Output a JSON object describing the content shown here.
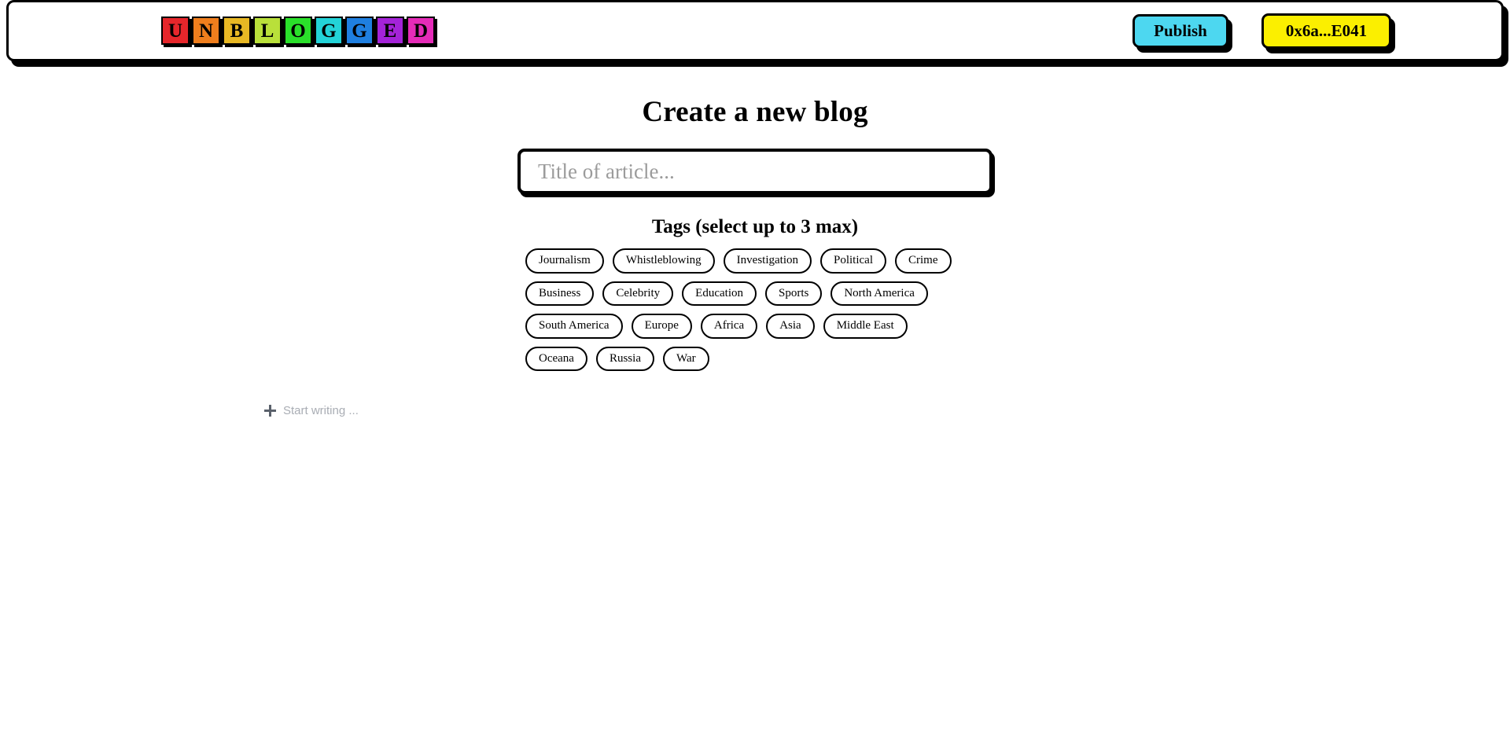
{
  "header": {
    "logo": {
      "name": "unblogged-logo",
      "tiles": [
        {
          "letter": "U",
          "color": "#e6262b"
        },
        {
          "letter": "N",
          "color": "#ef7e1d"
        },
        {
          "letter": "B",
          "color": "#e8b824"
        },
        {
          "letter": "L",
          "color": "#b9e03a"
        },
        {
          "letter": "O",
          "color": "#2ae02a"
        },
        {
          "letter": "G",
          "color": "#23d3d8"
        },
        {
          "letter": "G",
          "color": "#1f7fe0"
        },
        {
          "letter": "E",
          "color": "#a423d8"
        },
        {
          "letter": "D",
          "color": "#e52bb8"
        }
      ]
    },
    "publish_label": "Publish",
    "wallet_label": "0x6a...E041",
    "publish_color": "#4dd7f0",
    "wallet_color": "#fbef00"
  },
  "main": {
    "page_title": "Create a new blog",
    "title_input": {
      "value": "",
      "placeholder": "Title of article..."
    },
    "tags_heading": "Tags (select up to 3 max)",
    "tags": [
      "Journalism",
      "Whistleblowing",
      "Investigation",
      "Political",
      "Crime",
      "Business",
      "Celebrity",
      "Education",
      "Sports",
      "North America",
      "South America",
      "Europe",
      "Africa",
      "Asia",
      "Middle East",
      "Oceana",
      "Russia",
      "War"
    ],
    "editor": {
      "add_icon": "plus-icon",
      "placeholder": "Start writing ..."
    }
  }
}
